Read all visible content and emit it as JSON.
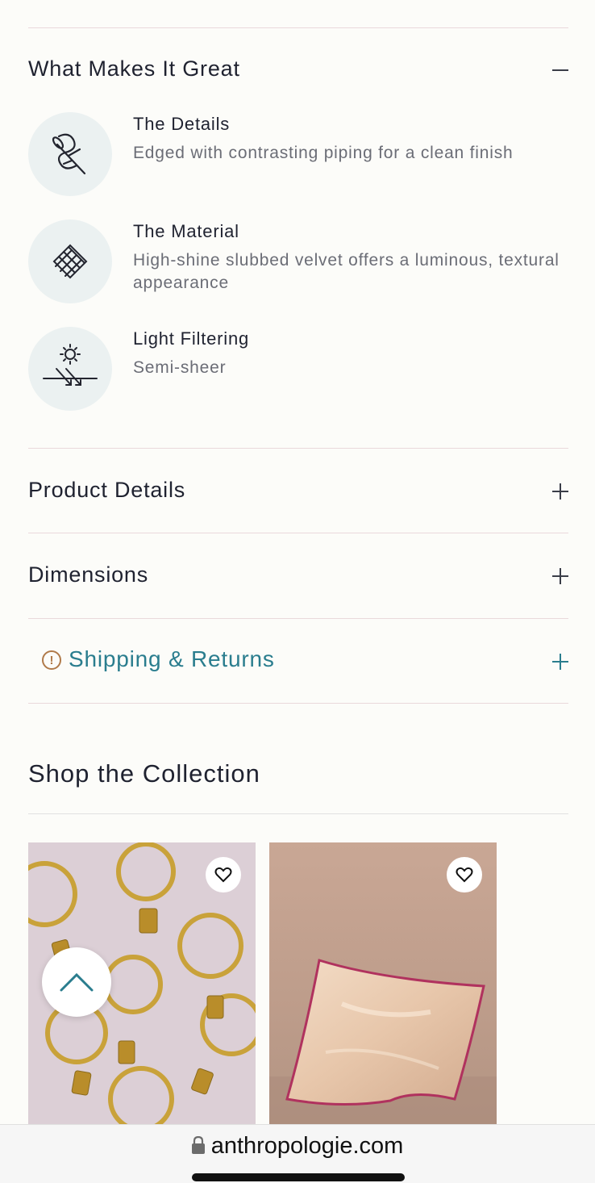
{
  "great": {
    "title": "What Makes It Great",
    "toggle": "minus",
    "features": [
      {
        "icon": "needle-thread-icon",
        "title": "The Details",
        "desc": "Edged with contrasting piping for a clean finish"
      },
      {
        "icon": "weave-icon",
        "title": "The Material",
        "desc": "High-shine slubbed velvet offers a luminous, textural appearance"
      },
      {
        "icon": "sun-light-icon",
        "title": "Light Filtering",
        "desc": "Semi-sheer"
      }
    ]
  },
  "accordion": {
    "product_details": "Product Details",
    "dimensions": "Dimensions",
    "shipping": "Shipping & Returns"
  },
  "collection": {
    "title": "Shop the Collection",
    "products": [
      {
        "image": "gold-curtain-rings-photo"
      },
      {
        "image": "velvet-pillow-photo"
      }
    ]
  },
  "browser": {
    "url": "anthropologie.com"
  },
  "colors": {
    "accent": "#2a7d8e",
    "warning": "#b07a4a",
    "background": "#fcfcf9",
    "icon_circle": "#ebf1f1"
  }
}
